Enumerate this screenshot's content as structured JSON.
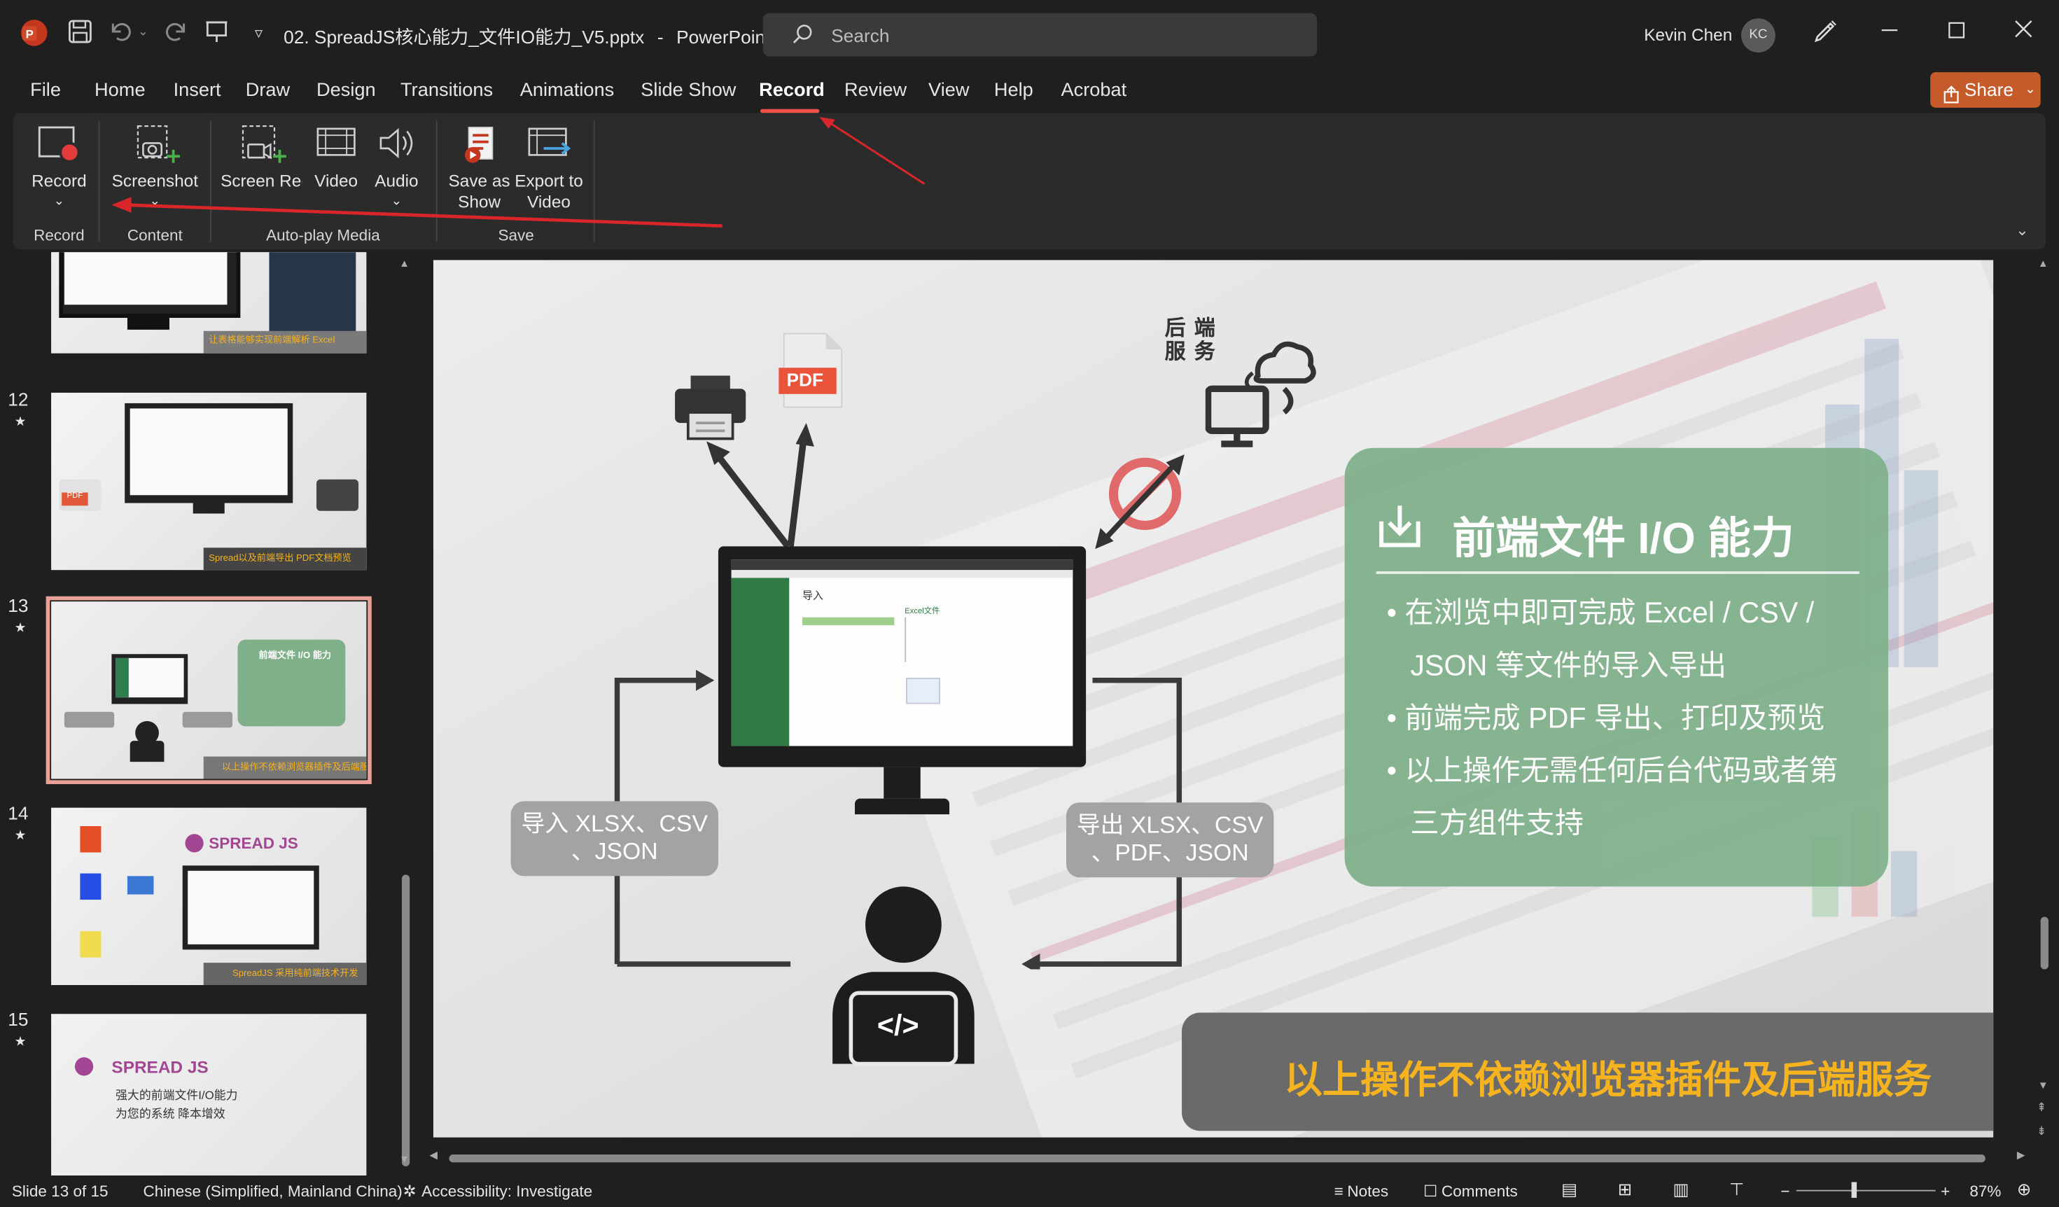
{
  "window": {
    "doc_title": "02. SpreadJS核心能力_文件IO能力_V5.pptx",
    "separator": "-",
    "app_name": "PowerPoint",
    "search_placeholder": "Search",
    "user_name": "Kevin Chen",
    "user_initials": "KC"
  },
  "menu": {
    "tabs": [
      "File",
      "Home",
      "Insert",
      "Draw",
      "Design",
      "Transitions",
      "Animations",
      "Slide Show",
      "Record",
      "Review",
      "View",
      "Help",
      "Acrobat"
    ],
    "active": "Record",
    "share_label": "Share"
  },
  "ribbon": {
    "record_label": "Record",
    "screenshot_label": "Screenshot",
    "screen_recording_label": "Screen Recording",
    "video_label": "Video",
    "audio_label": "Audio",
    "save_as_show_label": "Save as Show",
    "export_to_video_label": "Export to Video",
    "groups": {
      "record": "Record",
      "content": "Content",
      "autoplay": "Auto-play Media",
      "save": "Save"
    }
  },
  "thumbnails": [
    {
      "num": "12",
      "star": "★",
      "caption": "Spread以及前端导出 PDF文档预览"
    },
    {
      "num": "13",
      "star": "★",
      "caption": "以上操作不依赖浏览器插件及后端服务",
      "selected": true
    },
    {
      "num": "14",
      "star": "★",
      "caption": "SpreadJS 采用纯前端技术开发"
    },
    {
      "num": "15",
      "star": "★",
      "brand": "SPREAD JS",
      "line1": "强大的前端文件I/O能力",
      "line2": "为您的系统 降本增效"
    }
  ],
  "thumb_top_caption": "让表格能够实现前端解析 Excel",
  "slide": {
    "card_title": "前端文件 I/O 能力",
    "bullets": [
      "• 在浏览中即可完成 Excel / CSV /",
      "JSON 等文件的导入导出",
      "• 前端完成 PDF 导出、打印及预览",
      "• 以上操作无需任何后台代码或者第",
      "三方组件支持"
    ],
    "backend_label_line1": "后 端",
    "backend_label_line2": "服 务",
    "pdf_label": "PDF",
    "import_label_line1": "导入 XLSX、CSV",
    "import_label_line2": "、JSON",
    "export_label_line1": "导出 XLSX、CSV",
    "export_label_line2": "、PDF、JSON",
    "bottom_banner": "以上操作不依赖浏览器插件及后端服务",
    "screen_heading": "导入",
    "screen_sub": "Excel文件",
    "code_symbol": "</>"
  },
  "status": {
    "slide_info": "Slide 13 of 15",
    "language": "Chinese (Simplified, Mainland China)",
    "accessibility": "Accessibility: Investigate",
    "notes": "Notes",
    "comments": "Comments",
    "zoom": "87%"
  },
  "colors": {
    "accent_tab": "#f0504a",
    "share": "#c55a2a",
    "card_green": "#7fb08a",
    "banner_text": "#f5b31f",
    "annotation_arrow": "#d9262b"
  }
}
